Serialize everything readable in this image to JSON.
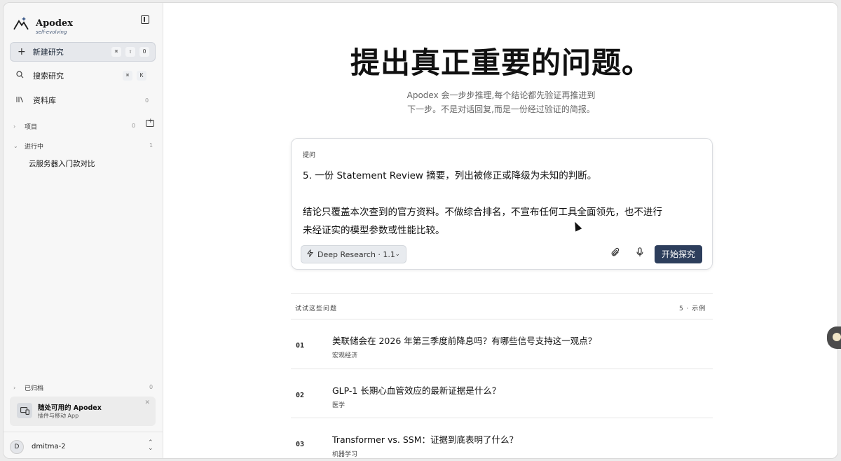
{
  "sidebar": {
    "brand": "Apodex",
    "tagline": "self-evolving",
    "new_research": {
      "label": "新建研究",
      "shortcut": [
        "⌘",
        "⇧",
        "O"
      ]
    },
    "search": {
      "label": "搜索研究",
      "shortcut": [
        "⌘",
        "K"
      ]
    },
    "library": {
      "label": "资料库",
      "count": "0"
    },
    "projects": {
      "label": "项目",
      "count": "0"
    },
    "ongoing": {
      "label": "进行中",
      "count": "1",
      "items": [
        "云服务器入门款对比"
      ]
    },
    "archived": {
      "label": "已归档",
      "count": "0"
    },
    "promo": {
      "title": "随处可用的 Apodex",
      "subtitle": "插件与移动 App"
    },
    "user": {
      "initial": "D",
      "name": "dmitma-2"
    }
  },
  "main": {
    "headline": "提出真正重要的问题。",
    "subtitle_line1": "Apodex 会一步步推理,每个结论都先验证再推进到",
    "subtitle_line2": "下一步。不是对话回复,而是一份经过验证的简报。",
    "prompt": {
      "label": "提问",
      "line1": "5. 一份 Statement Review 摘要，列出被修正或降级为未知的判断。",
      "line2": "",
      "line3": "结论只覆盖本次查到的官方资料。不做综合排名，不宣布任何工具全面领先，也不进行",
      "line4": "未经证实的模型参数或性能比较。",
      "mode": "Deep Research · 1.1",
      "start_label": "开始探究"
    },
    "examples": {
      "label": "试试这些问题",
      "count": "5 · 示例",
      "items": [
        {
          "num": "01",
          "title": "美联储会在 2026 年第三季度前降息吗？有哪些信号支持这一观点？",
          "tag": "宏观经济"
        },
        {
          "num": "02",
          "title": "GLP-1 长期心血管效应的最新证据是什么？",
          "tag": "医学"
        },
        {
          "num": "03",
          "title": "Transformer vs. SSM：证据到底表明了什么？",
          "tag": "机器学习"
        }
      ]
    }
  }
}
